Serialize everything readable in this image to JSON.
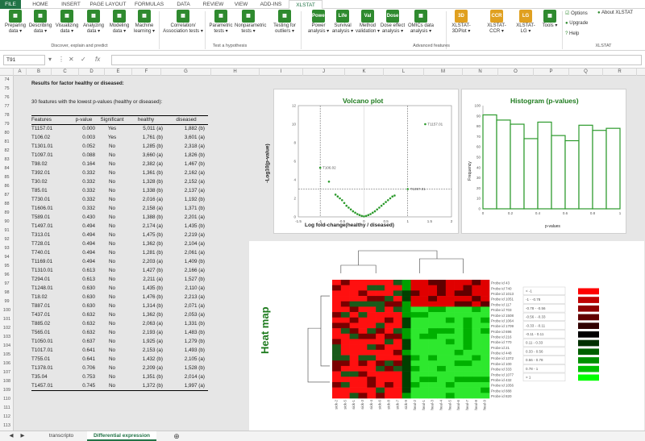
{
  "ribbon_tabs": [
    "FILE",
    "HOME",
    "INSERT",
    "PAGE LAYOUT",
    "FORMULAS",
    "DATA",
    "REVIEW",
    "VIEW",
    "ADD-INS",
    "XLSTAT"
  ],
  "ribbon_active": "XLSTAT",
  "ribbon_buttons": [
    {
      "label": "Preparing data ▾",
      "icon": "table-icon"
    },
    {
      "label": "Describing data ▾",
      "icon": "bar-chart-icon"
    },
    {
      "label": "Visualizing data ▾",
      "icon": "scatter-icon"
    },
    {
      "label": "Analyzing data ▾",
      "icon": "analyze-icon"
    },
    {
      "label": "Modeling data ▾",
      "icon": "modeling-icon"
    },
    {
      "label": "Machine learning ▾",
      "icon": "tree-icon"
    },
    {
      "label": "Correlation/ Association tests ▾",
      "icon": "correlation-icon"
    },
    {
      "label": "Parametric tests ▾",
      "icon": "parametric-icon"
    },
    {
      "label": "Nonparametric tests ▾",
      "icon": "nonparametric-icon"
    },
    {
      "label": "Testing for outliers ▾",
      "icon": "outlier-icon"
    },
    {
      "label": "Power analysis ▾",
      "icon": "power-icon",
      "text": "Power"
    },
    {
      "label": "Survival analysis ▾",
      "icon": "life-icon",
      "text": "Life"
    },
    {
      "label": "Method validation ▾",
      "icon": "val-icon",
      "text": "Val"
    },
    {
      "label": "Dose effect analysis ▾",
      "icon": "dose-icon",
      "text": "Dose"
    },
    {
      "label": "OMICs data analysis ▾",
      "icon": "omics-icon"
    },
    {
      "label": "XLSTAT-3DPlot ▾",
      "icon": "3d-icon",
      "text": "3D"
    },
    {
      "label": "XLSTAT- CCR ▾",
      "icon": "ccr-icon",
      "text": "CCR"
    },
    {
      "label": "XLSTAT- LG ▾",
      "icon": "lg-icon",
      "text": "LG"
    },
    {
      "label": "Tools ▾",
      "icon": "tools-icon"
    }
  ],
  "ribbon_side": [
    "Options",
    "Upgrade",
    "Help",
    "About XLSTAT"
  ],
  "ribbon_groups": [
    "Discover, explain and predict",
    "Test a hypothesis",
    "Advanced features",
    "XLSTAT"
  ],
  "namebox": "T91",
  "columns": [
    "A",
    "B",
    "C",
    "D",
    "E",
    "F",
    "G",
    "H",
    "I",
    "J",
    "K",
    "L",
    "M",
    "N",
    "O",
    "P",
    "Q",
    "R"
  ],
  "rows": [
    "74",
    "75",
    "76",
    "77",
    "78",
    "79",
    "80",
    "81",
    "82",
    "83",
    "84",
    "85",
    "86",
    "87",
    "88",
    "89",
    "90",
    "91",
    "92",
    "93",
    "94",
    "95",
    "96",
    "97",
    "98",
    "99",
    "100",
    "101",
    "102",
    "103",
    "104",
    "105",
    "106",
    "107",
    "108",
    "109",
    "110",
    "111",
    "112",
    "113"
  ],
  "results_title": "Results for factor healthy or diseased:",
  "results_sub": "30 features with the lowest p-values (healthy or diseased):",
  "table_headers": [
    "Features",
    "p-value",
    "Significant",
    "healthy",
    "diseased"
  ],
  "table_rows": [
    [
      "T1157.01",
      "0.000",
      "Yes",
      "5,011 (a)",
      "1,882 (b)"
    ],
    [
      "T106.02",
      "0.003",
      "Yes",
      "1,761 (b)",
      "3,601 (a)"
    ],
    [
      "T1301.01",
      "0.052",
      "No",
      "1,285 (b)",
      "2,318 (a)"
    ],
    [
      "T1097.01",
      "0.088",
      "No",
      "3,660 (a)",
      "1,826 (b)"
    ],
    [
      "T98.02",
      "0.164",
      "No",
      "2,382 (a)",
      "1,467 (b)"
    ],
    [
      "T392.01",
      "0.332",
      "No",
      "1,361 (b)",
      "2,162 (a)"
    ],
    [
      "T30.02",
      "0.332",
      "No",
      "1,328 (b)",
      "2,152 (a)"
    ],
    [
      "T85.01",
      "0.332",
      "No",
      "1,338 (b)",
      "2,137 (a)"
    ],
    [
      "T730.01",
      "0.332",
      "No",
      "2,016 (a)",
      "1,192 (b)"
    ],
    [
      "T1606.01",
      "0.332",
      "No",
      "2,158 (a)",
      "1,371 (b)"
    ],
    [
      "T589.01",
      "0.430",
      "No",
      "1,388 (b)",
      "2,201 (a)"
    ],
    [
      "T1497.01",
      "0.494",
      "No",
      "2,174 (a)",
      "1,435 (b)"
    ],
    [
      "T313.01",
      "0.494",
      "No",
      "1,475 (b)",
      "2,219 (a)"
    ],
    [
      "T728.01",
      "0.494",
      "No",
      "1,362 (b)",
      "2,104 (a)"
    ],
    [
      "T740.01",
      "0.494",
      "No",
      "1,281 (b)",
      "2,061 (a)"
    ],
    [
      "T1169.01",
      "0.494",
      "No",
      "2,203 (a)",
      "1,409 (b)"
    ],
    [
      "T1310.01",
      "0.613",
      "No",
      "1,427 (b)",
      "2,166 (a)"
    ],
    [
      "T294.01",
      "0.613",
      "No",
      "2,211 (a)",
      "1,527 (b)"
    ],
    [
      "T1248.01",
      "0.630",
      "No",
      "1,435 (b)",
      "2,110 (a)"
    ],
    [
      "T18.02",
      "0.630",
      "No",
      "1,476 (b)",
      "2,213 (a)"
    ],
    [
      "T887.01",
      "0.630",
      "No",
      "1,314 (b)",
      "2,071 (a)"
    ],
    [
      "T437.01",
      "0.632",
      "No",
      "1,362 (b)",
      "2,053 (a)"
    ],
    [
      "T885.02",
      "0.632",
      "No",
      "2,063 (a)",
      "1,331 (b)"
    ],
    [
      "T565.01",
      "0.632",
      "No",
      "2,193 (a)",
      "1,483 (b)"
    ],
    [
      "T1050.01",
      "0.637",
      "No",
      "1,925 (a)",
      "1,279 (b)"
    ],
    [
      "T1017.01",
      "0.641",
      "No",
      "2,153 (a)",
      "1,493 (b)"
    ],
    [
      "T755.01",
      "0.641",
      "No",
      "1,432 (b)",
      "2,105 (a)"
    ],
    [
      "T1378.01",
      "0.706",
      "No",
      "2,209 (a)",
      "1,528 (b)"
    ],
    [
      "T35.04",
      "0.753",
      "No",
      "1,351 (b)",
      "2,014 (a)"
    ],
    [
      "T1457.01",
      "0.745",
      "No",
      "1,372 (b)",
      "1,997 (a)"
    ]
  ],
  "sheet_tabs": [
    "transcripto",
    "Differential expression"
  ],
  "sheet_active": "Differential expression",
  "chart_data": [
    {
      "type": "scatter",
      "title": "Volcano plot",
      "xlabel": "Log fold-change(healthy / diseased)",
      "ylabel": "-Log10(p-value)",
      "xlim": [
        -1.5,
        2
      ],
      "ylim": [
        0,
        12
      ],
      "x_ticks": [
        "-1.5",
        "-1",
        "-0.5",
        "0",
        "0.5",
        "1",
        "1.5",
        "2"
      ],
      "y_ticks": [
        "0",
        "2",
        "4",
        "6",
        "8",
        "10",
        "12"
      ],
      "labels": [
        {
          "text": "T1157.01",
          "x": 1.4,
          "y": 10.0
        },
        {
          "text": "T106.02",
          "x": -1.0,
          "y": 5.3
        },
        {
          "text": "T1097.01",
          "x": 1.0,
          "y": 3.0
        }
      ],
      "points": [
        [
          1.4,
          10.0
        ],
        [
          -1.0,
          5.3
        ],
        [
          -0.8,
          3.8
        ],
        [
          1.0,
          3.0
        ],
        [
          -0.6,
          2.2
        ],
        [
          -0.5,
          1.8
        ],
        [
          -0.45,
          1.5
        ],
        [
          -0.4,
          1.2
        ],
        [
          -0.35,
          1.0
        ],
        [
          -0.3,
          0.8
        ],
        [
          -0.25,
          0.6
        ],
        [
          -0.2,
          0.45
        ],
        [
          -0.15,
          0.3
        ],
        [
          -0.1,
          0.2
        ],
        [
          -0.05,
          0.1
        ],
        [
          0.0,
          0.05
        ],
        [
          0.05,
          0.1
        ],
        [
          0.1,
          0.2
        ],
        [
          0.15,
          0.3
        ],
        [
          0.2,
          0.45
        ],
        [
          0.25,
          0.6
        ],
        [
          0.3,
          0.8
        ],
        [
          0.35,
          1.0
        ],
        [
          0.4,
          1.2
        ],
        [
          0.45,
          1.4
        ],
        [
          0.5,
          1.6
        ],
        [
          0.55,
          1.8
        ],
        [
          0.6,
          2.0
        ],
        [
          0.7,
          2.3
        ],
        [
          -0.55,
          2.0
        ],
        [
          -0.65,
          2.4
        ],
        [
          0.65,
          2.2
        ]
      ],
      "color": "#2c9a2c"
    },
    {
      "type": "bar",
      "title": "Histogram (p-values)",
      "xlabel": "p-values",
      "ylabel": "Frequency",
      "xlim": [
        0,
        1
      ],
      "ylim": [
        0,
        100
      ],
      "x_ticks": [
        "0",
        "0.2",
        "0.4",
        "0.6",
        "0.8",
        "1"
      ],
      "y_ticks": [
        "0",
        "10",
        "20",
        "30",
        "40",
        "50",
        "60",
        "70",
        "80",
        "90",
        "100"
      ],
      "values": [
        91,
        86,
        82,
        68,
        84,
        71,
        66,
        81,
        76,
        78
      ],
      "color": "#2c9a2c"
    }
  ],
  "heatmap": {
    "title": "Heat map",
    "legend": [
      "< -1",
      "-1 - -0.78",
      "-0.78 - -0.56",
      "-0.56 - -0.33",
      "-0.33 - -0.11",
      "-0.11 - 0.11",
      "0.11 - 0.33",
      "0.33 - 0.56",
      "0.56 - 0.78",
      "0.78 - 1",
      "> 1"
    ],
    "legend_colors": [
      "#ff0000",
      "#c00000",
      "#900000",
      "#600000",
      "#300000",
      "#000000",
      "#003000",
      "#006000",
      "#009000",
      "#00c000",
      "#00ff00"
    ],
    "cols": [
      "sick-2",
      "sick-5",
      "sick-1",
      "sick-3",
      "sick-4",
      "sick-6",
      "sick-8",
      "sick-7",
      "sick-9",
      "heal-2",
      "heal-1",
      "heal-3",
      "heal-4",
      "heal-5",
      "heal-6",
      "heal-7",
      "heal-8",
      "heal-9"
    ],
    "rows": [
      "Probe id 43",
      "Probe id 740",
      "Probe id 1013",
      "Probe id 1051",
      "Probe id 117",
      "Probe id 703",
      "Probe id 1508",
      "Probe id 1064",
      "Probe id 1709",
      "Probe id 696",
      "Probe id 216",
      "Probe id 770",
      "Probe id 21",
      "Probe id 448",
      "Probe id 1372",
      "Probe id 100",
      "Probe id 333",
      "Probe id 1077",
      "Probe id 432",
      "Probe id 1056",
      "Probe id 888",
      "Probe id 820"
    ]
  }
}
